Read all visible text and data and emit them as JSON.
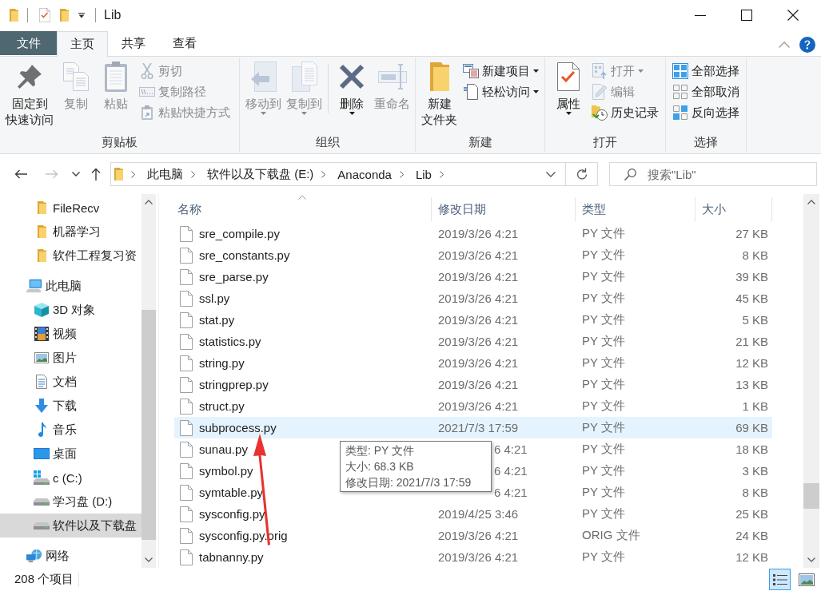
{
  "window": {
    "title": "Lib"
  },
  "ribbon_tabs": [
    {
      "label": "文件",
      "kind": "file",
      "selected": false
    },
    {
      "label": "主页",
      "kind": "tab",
      "selected": true
    },
    {
      "label": "共享",
      "kind": "tab",
      "selected": false
    },
    {
      "label": "查看",
      "kind": "tab",
      "selected": false
    }
  ],
  "ribbon_groups": [
    {
      "label": "剪贴板",
      "items": [
        {
          "kind": "large",
          "lines": [
            "固定到",
            "快速访问"
          ],
          "disabled": false,
          "dropdown": false
        },
        {
          "kind": "large",
          "lines": [
            "复制"
          ],
          "disabled": true,
          "dropdown": false
        },
        {
          "kind": "large",
          "lines": [
            "粘贴"
          ],
          "disabled": true,
          "dropdown": false
        },
        {
          "kind": "small",
          "lines": [
            "剪切"
          ],
          "disabled": true,
          "dropdown": false
        },
        {
          "kind": "small",
          "lines": [
            "复制路径"
          ],
          "disabled": true,
          "dropdown": false
        },
        {
          "kind": "small",
          "lines": [
            "粘贴快捷方式"
          ],
          "disabled": true,
          "dropdown": false
        }
      ]
    },
    {
      "label": "组织",
      "items": [
        {
          "kind": "large",
          "lines": [
            "移动到"
          ],
          "disabled": true,
          "dropdown": true
        },
        {
          "kind": "large",
          "lines": [
            "复制到"
          ],
          "disabled": true,
          "dropdown": true
        },
        {
          "kind": "separator"
        },
        {
          "kind": "large",
          "lines": [
            "删除"
          ],
          "disabled": false,
          "dropdown": true
        },
        {
          "kind": "large",
          "lines": [
            "重命名"
          ],
          "disabled": true,
          "dropdown": false
        }
      ]
    },
    {
      "label": "新建",
      "items": [
        {
          "kind": "large",
          "lines": [
            "新建",
            "文件夹"
          ],
          "disabled": false,
          "dropdown": false
        },
        {
          "kind": "small",
          "lines": [
            "新建项目"
          ],
          "disabled": false,
          "dropdown": true
        },
        {
          "kind": "small",
          "lines": [
            "轻松访问"
          ],
          "disabled": false,
          "dropdown": true
        }
      ]
    },
    {
      "label": "打开",
      "items": [
        {
          "kind": "large",
          "lines": [
            "属性"
          ],
          "disabled": false,
          "dropdown": true
        },
        {
          "kind": "small",
          "lines": [
            "打开"
          ],
          "disabled": true,
          "dropdown": true
        },
        {
          "kind": "small",
          "lines": [
            "编辑"
          ],
          "disabled": true,
          "dropdown": false
        },
        {
          "kind": "small",
          "lines": [
            "历史记录"
          ],
          "disabled": false,
          "dropdown": false
        }
      ]
    },
    {
      "label": "选择",
      "items": [
        {
          "kind": "small",
          "lines": [
            "全部选择"
          ],
          "disabled": false,
          "dropdown": false
        },
        {
          "kind": "small",
          "lines": [
            "全部取消"
          ],
          "disabled": false,
          "dropdown": false
        },
        {
          "kind": "small",
          "lines": [
            "反向选择"
          ],
          "disabled": false,
          "dropdown": false
        }
      ]
    }
  ],
  "nav_buttons": [
    {
      "disabled": false
    },
    {
      "disabled": true
    },
    {
      "disabled": false
    },
    {
      "disabled": false
    }
  ],
  "breadcrumb": [
    "此电脑",
    "软件以及下载盘 (E:)",
    "Anaconda",
    "Lib"
  ],
  "search": {
    "placeholder": "搜索\"Lib\""
  },
  "sidebar": {
    "items": [
      {
        "children": [
          {
            "label": "FileRecv",
            "selected": false
          },
          {
            "label": "机器学习",
            "selected": false
          },
          {
            "label": "软件工程复习资",
            "selected": false
          }
        ]
      },
      {
        "label": "此电脑",
        "selected": false,
        "children": [
          {
            "label": "3D 对象",
            "selected": false
          },
          {
            "label": "视频",
            "selected": false
          },
          {
            "label": "图片",
            "selected": false
          },
          {
            "label": "文档",
            "selected": false
          },
          {
            "label": "下载",
            "selected": false
          },
          {
            "label": "音乐",
            "selected": false
          },
          {
            "label": "桌面",
            "selected": false
          },
          {
            "label": "c (C:)",
            "selected": false
          },
          {
            "label": "学习盘 (D:)",
            "selected": false
          },
          {
            "label": "软件以及下载盘",
            "selected": true
          }
        ]
      },
      {
        "label": "网络",
        "selected": false
      }
    ]
  },
  "file_list": {
    "columns": [
      {
        "label": "名称",
        "sorted": true
      },
      {
        "label": "修改日期",
        "sorted": false
      },
      {
        "label": "类型",
        "sorted": false
      },
      {
        "label": "大小",
        "sorted": false
      }
    ],
    "rows": [
      {
        "name": "sre_compile.py",
        "modified": "2019/3/26 4:21",
        "type": "PY 文件",
        "size": "27 KB",
        "hovered": false
      },
      {
        "name": "sre_constants.py",
        "modified": "2019/3/26 4:21",
        "type": "PY 文件",
        "size": "8 KB",
        "hovered": false
      },
      {
        "name": "sre_parse.py",
        "modified": "2019/3/26 4:21",
        "type": "PY 文件",
        "size": "39 KB",
        "hovered": false
      },
      {
        "name": "ssl.py",
        "modified": "2019/3/26 4:21",
        "type": "PY 文件",
        "size": "45 KB",
        "hovered": false
      },
      {
        "name": "stat.py",
        "modified": "2019/3/26 4:21",
        "type": "PY 文件",
        "size": "5 KB",
        "hovered": false
      },
      {
        "name": "statistics.py",
        "modified": "2019/3/26 4:21",
        "type": "PY 文件",
        "size": "21 KB",
        "hovered": false
      },
      {
        "name": "string.py",
        "modified": "2019/3/26 4:21",
        "type": "PY 文件",
        "size": "12 KB",
        "hovered": false
      },
      {
        "name": "stringprep.py",
        "modified": "2019/3/26 4:21",
        "type": "PY 文件",
        "size": "13 KB",
        "hovered": false
      },
      {
        "name": "struct.py",
        "modified": "2019/3/26 4:21",
        "type": "PY 文件",
        "size": "1 KB",
        "hovered": false
      },
      {
        "name": "subprocess.py",
        "modified": "2021/7/3 17:59",
        "type": "PY 文件",
        "size": "69 KB",
        "hovered": true
      },
      {
        "name": "sunau.py",
        "modified": "6 4:21",
        "type": "PY 文件",
        "size": "18 KB",
        "hovered": false
      },
      {
        "name": "symbol.py",
        "modified": "6 4:21",
        "type": "PY 文件",
        "size": "3 KB",
        "hovered": false
      },
      {
        "name": "symtable.py",
        "modified": "6 4:21",
        "type": "PY 文件",
        "size": "8 KB",
        "hovered": false
      },
      {
        "name": "sysconfig.py",
        "modified": "2019/4/25 3:46",
        "type": "PY 文件",
        "size": "25 KB",
        "hovered": false
      },
      {
        "name": "sysconfig.py.orig",
        "modified": "2019/3/26 4:21",
        "type": "ORIG 文件",
        "size": "24 KB",
        "hovered": false
      },
      {
        "name": "tabnanny.py",
        "modified": "2019/3/26 4:21",
        "type": "PY 文件",
        "size": "12 KB",
        "hovered": false
      }
    ],
    "tooltip": {
      "lines": [
        "类型: PY 文件",
        "大小: 68.3 KB",
        "修改日期: 2021/7/3 17:59"
      ]
    }
  },
  "status_bar": {
    "item_count": "208 个项目",
    "view_buttons": [
      {
        "selected": true
      },
      {
        "selected": false
      }
    ]
  }
}
